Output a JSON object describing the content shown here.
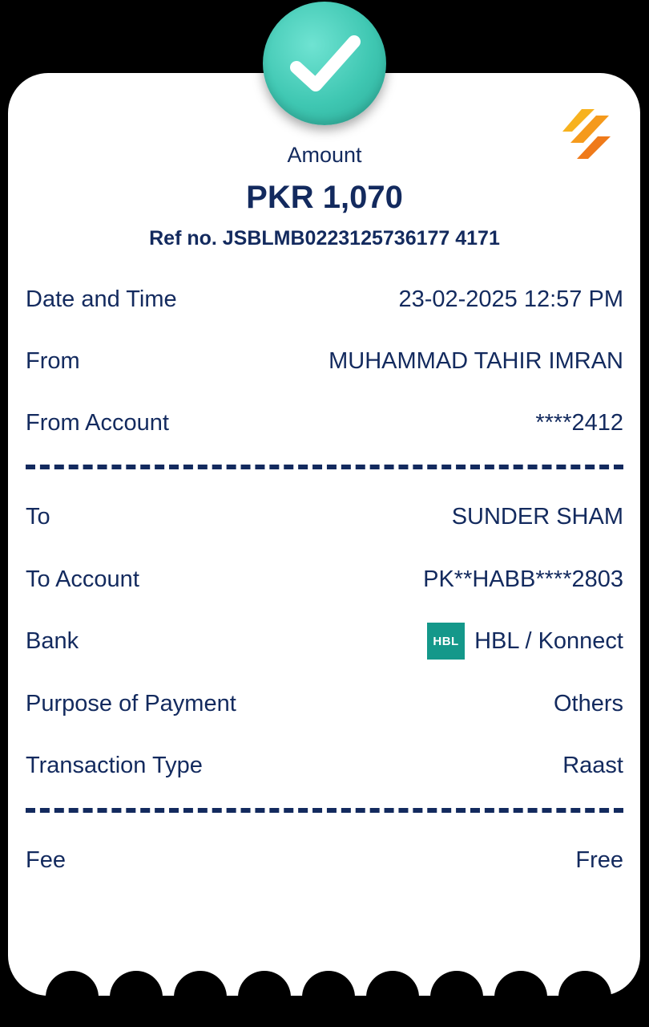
{
  "receipt": {
    "amount_label": "Amount",
    "amount_value": "PKR 1,070",
    "ref_line": "Ref no. JSBLMB0223125736177 4171"
  },
  "details": [
    {
      "label": "Date and Time",
      "value": "23-02-2025 12:57 PM"
    },
    {
      "label": "From",
      "value": "MUHAMMAD TAHIR IMRAN"
    },
    {
      "label": "From Account",
      "value": "****2412"
    },
    {
      "label": "To",
      "value": "SUNDER SHAM"
    },
    {
      "label": "To Account",
      "value": "PK**HABB****2803"
    },
    {
      "label": "Bank",
      "value": "HBL / Konnect",
      "bank_logo_text": "HBL"
    },
    {
      "label": "Purpose of Payment",
      "value": "Others"
    },
    {
      "label": "Transaction Type",
      "value": "Raast"
    },
    {
      "label": "Fee",
      "value": "Free"
    }
  ],
  "icons": {
    "success": "check-icon",
    "brand": "brand-logo-icon"
  },
  "colors": {
    "text": "#132a5e",
    "success_badge": "#3fc7b2",
    "hbl": "#14988a",
    "brand_orange": "#f59a1c"
  }
}
